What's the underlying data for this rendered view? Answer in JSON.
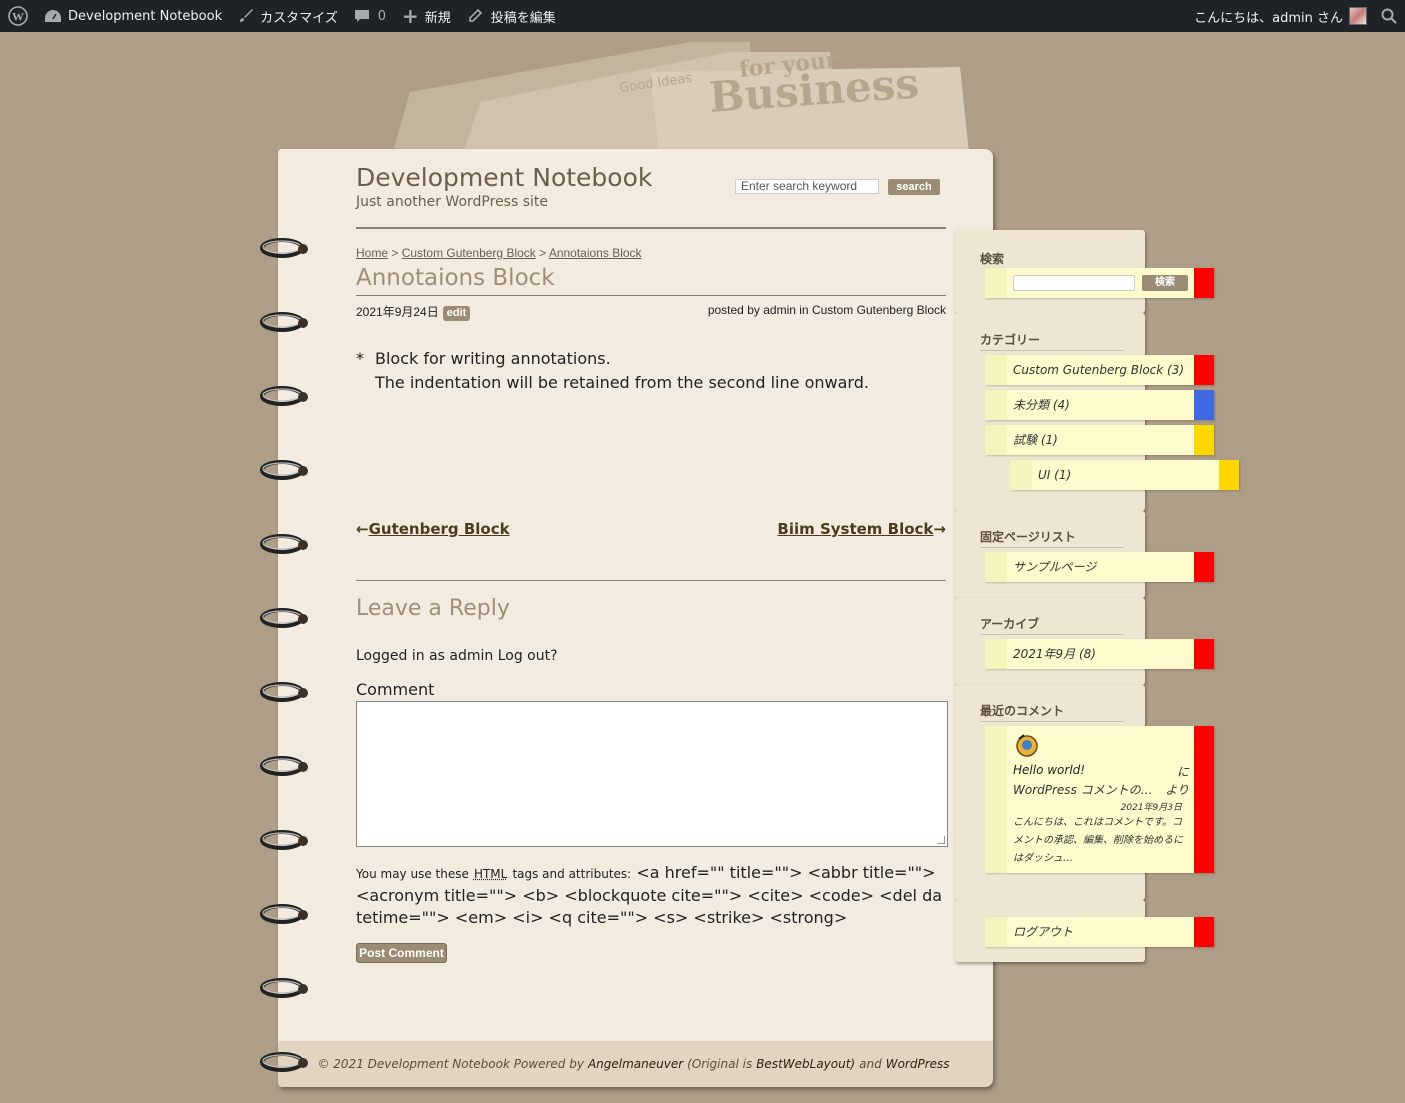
{
  "adminbar": {
    "wp_icon": "wordpress-logo-icon",
    "site_name": "Development Notebook",
    "customize": "カスタマイズ",
    "comments_count": "0",
    "new": "新規",
    "edit_post": "投稿を編集",
    "greeting": "こんにちは、admin さん"
  },
  "site": {
    "title": "Development Notebook",
    "description": "Just another WordPress site",
    "search_placeholder": "Enter search keyword",
    "search_button": "search"
  },
  "breadcrumb": {
    "home": "Home",
    "sep": ">",
    "category": "Custom Gutenberg Block",
    "current": "Annotaions Block"
  },
  "post": {
    "title": "Annotaions Block",
    "date": "2021年9月24日",
    "edit": "edit",
    "posted_by": "posted by",
    "author": "admin",
    "in": "in",
    "category": "Custom Gutenberg Block",
    "annotation_mark": "*",
    "annotation_line1": "Block for writing annotations.",
    "annotation_line2": "The indentation will be retained from the second line onward."
  },
  "nav": {
    "prev_arrow": "←",
    "prev": "Gutenberg Block",
    "next": "Biim System Block",
    "next_arrow": "→"
  },
  "reply": {
    "title": "Leave a Reply",
    "logged_in": "Logged in as admin Log out?",
    "comment_label": "Comment",
    "allowed_lead": "You may use these",
    "allowed_html": "HTML",
    "allowed_mid": "tags and attributes:",
    "allowed_tags": "<a href=\"\" title=\"\"> <abbr title=\"\"> <acronym title=\"\"> <b> <blockquote cite=\"\"> <cite> <code> <del datetime=\"\"> <em> <i> <q cite=\"\"> <s> <strike> <strong>",
    "submit": "Post Comment"
  },
  "footer": {
    "copy": "© 2021 Development Notebook Powered by",
    "powered": "Angelmaneuver",
    "original_pre": "(Original is",
    "original": "BestWebLayout)",
    "and": "and",
    "wp": "WordPress"
  },
  "sidebar": {
    "search": {
      "title": "検索",
      "button": "検索",
      "color": "#ff0000"
    },
    "categories": {
      "title": "カテゴリー",
      "items": [
        {
          "label": "Custom Gutenberg Block (3)",
          "color": "#ff0000"
        },
        {
          "label": "未分類 (4)",
          "color": "#4169e1"
        },
        {
          "label": "試験 (1)",
          "color": "#ffd700"
        },
        {
          "label": "UI (1)",
          "color": "#ffd700"
        }
      ]
    },
    "pages": {
      "title": "固定ページリスト",
      "items": [
        {
          "label": "サンプルページ",
          "color": "#ff0000"
        }
      ]
    },
    "archives": {
      "title": "アーカイブ",
      "items": [
        {
          "label": "2021年9月 (8)",
          "color": "#ff0000"
        }
      ]
    },
    "recent_comments": {
      "title": "最近のコメント",
      "post": "Hello world!",
      "ni": "に",
      "author": "WordPress コメントの…",
      "yori": "より",
      "date": "2021年9月3日",
      "excerpt": "こんにちは、これはコメントです。コメントの承認、編集、削除を始めるにはダッシュ…",
      "color": "#ff0000"
    },
    "logout": {
      "label": "ログアウト",
      "color": "#ff0000"
    }
  }
}
